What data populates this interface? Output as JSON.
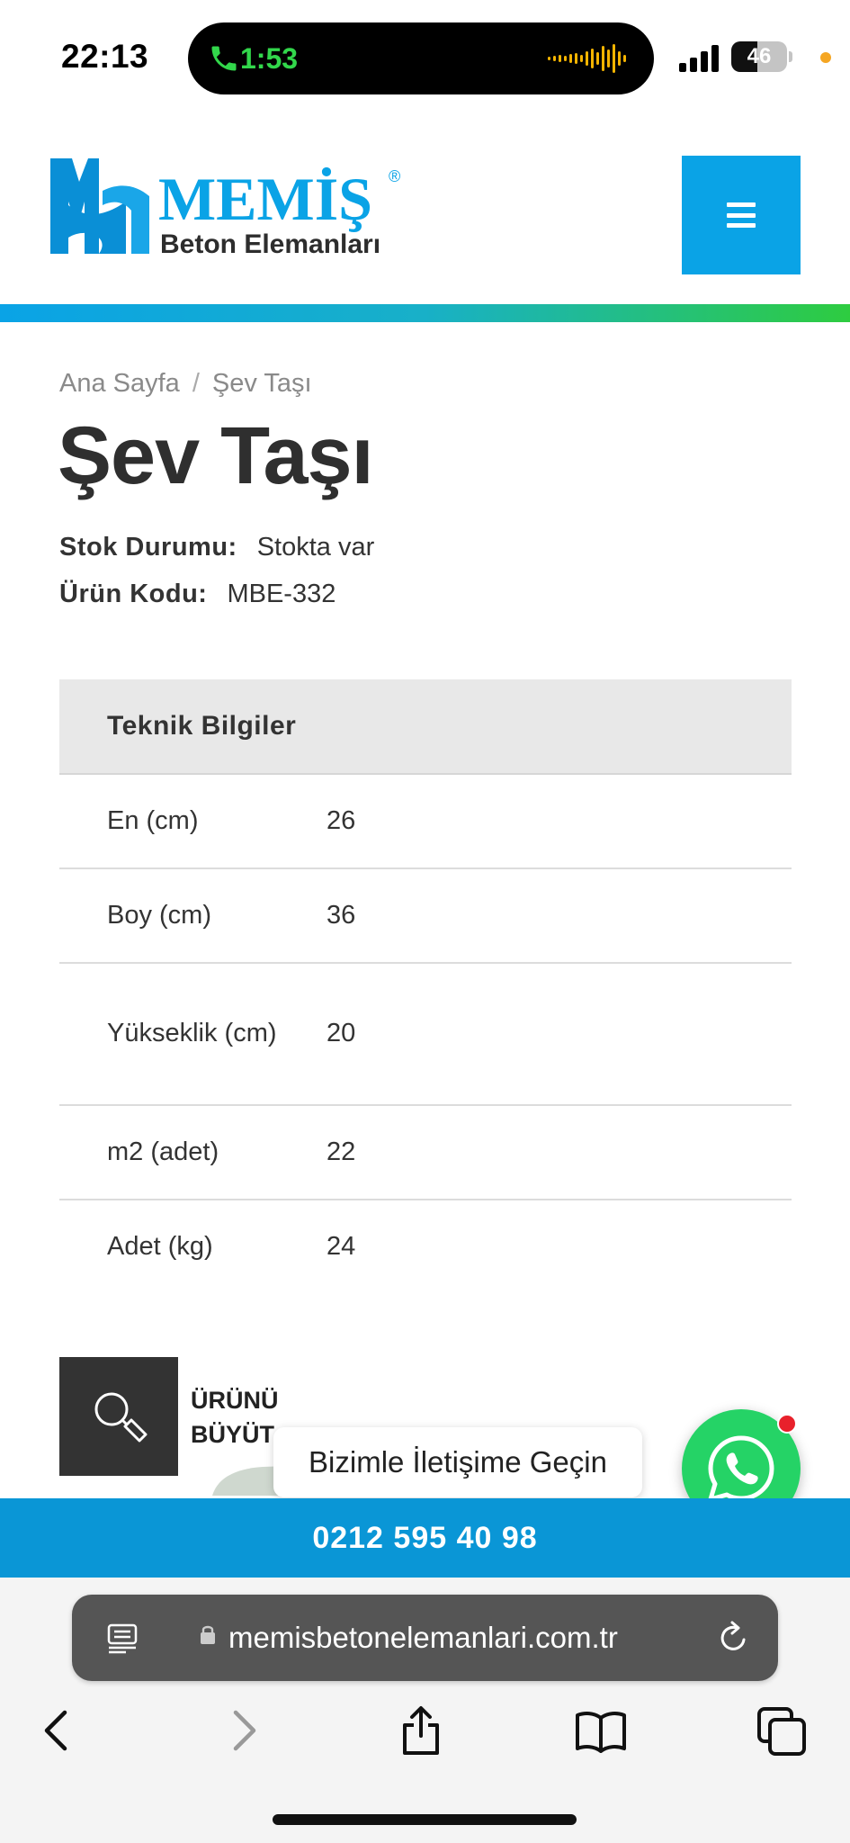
{
  "status_bar": {
    "time": "22:13",
    "call_duration": "1:53",
    "battery_percent": "46",
    "battery_level": 0.46
  },
  "header": {
    "logo_brand": "MEMİŞ",
    "logo_tagline": "Beton Elemanları",
    "logo_registered": "®",
    "colors": {
      "accent": "#0aa3e6",
      "gradient_end": "#2ecc40"
    }
  },
  "breadcrumb": {
    "home": "Ana Sayfa",
    "separator": "/",
    "current": "Şev Taşı"
  },
  "product": {
    "title": "Şev Taşı",
    "stock_label": "Stok Durumu:",
    "stock_value": "Stokta var",
    "code_label": "Ürün Kodu:",
    "code_value": "MBE-332"
  },
  "specs": {
    "heading": "Teknik Bilgiler",
    "rows": [
      {
        "key": "En (cm)",
        "value": "26"
      },
      {
        "key": "Boy (cm)",
        "value": "36"
      },
      {
        "key": "Yükseklik (cm)",
        "value": "20"
      },
      {
        "key": "m2 (adet)",
        "value": "22"
      },
      {
        "key": "Adet (kg)",
        "value": "24"
      }
    ]
  },
  "zoom": {
    "label_line1": "ÜRÜNÜ",
    "label_line2": "BÜYÜT",
    "icon": "magnifier-icon"
  },
  "contact": {
    "bubble_text": "Bizimle İletişime Geçin",
    "whatsapp_icon": "whatsapp-icon",
    "phone": "0212 595 40 98"
  },
  "browser": {
    "url": "memisbetonelemanlari.com.tr",
    "icons": [
      "reader-icon",
      "lock-icon",
      "reload-icon",
      "back-icon",
      "forward-icon",
      "share-icon",
      "bookmarks-icon",
      "tabs-icon"
    ]
  }
}
